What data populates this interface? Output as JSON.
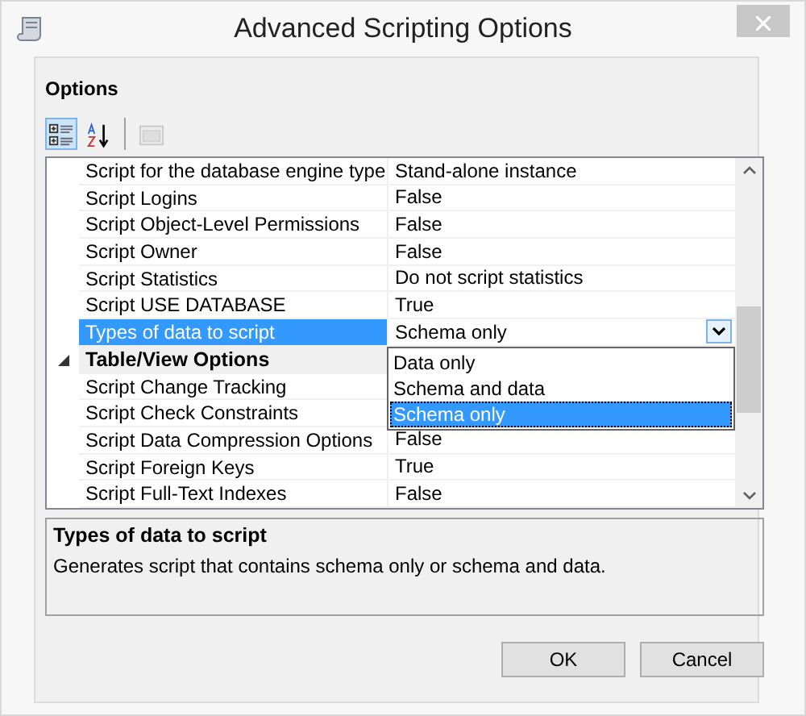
{
  "window": {
    "title": "Advanced Scripting Options"
  },
  "options_label": "Options",
  "toolbar": [
    {
      "kind": "categorized",
      "selected": true,
      "disabled": false
    },
    {
      "kind": "alphabetical",
      "selected": false,
      "disabled": false
    },
    {
      "kind": "property-pages",
      "selected": false,
      "disabled": true
    }
  ],
  "grid": {
    "rows": [
      {
        "kind": "property",
        "name": "Script for the database engine type",
        "value": "Stand-alone instance",
        "selected": false
      },
      {
        "kind": "property",
        "name": "Script Logins",
        "value": "False",
        "selected": false
      },
      {
        "kind": "property",
        "name": "Script Object-Level Permissions",
        "value": "False",
        "selected": false
      },
      {
        "kind": "property",
        "name": "Script Owner",
        "value": "False",
        "selected": false
      },
      {
        "kind": "property",
        "name": "Script Statistics",
        "value": "Do not script statistics",
        "selected": false
      },
      {
        "kind": "property",
        "name": "Script USE DATABASE",
        "value": "True",
        "selected": false
      },
      {
        "kind": "property",
        "name": "Types of data to script",
        "value": "Schema only",
        "selected": true
      },
      {
        "kind": "category",
        "name": "Table/View Options",
        "expanded": true
      },
      {
        "kind": "property",
        "name": "Script Change Tracking",
        "selected": false
      },
      {
        "kind": "property",
        "name": "Script Check Constraints",
        "selected": false
      },
      {
        "kind": "property",
        "name": "Script Data Compression Options",
        "value": "False",
        "selected": false
      },
      {
        "kind": "property",
        "name": "Script Foreign Keys",
        "value": "True",
        "selected": false
      },
      {
        "kind": "property",
        "name": "Script Full-Text Indexes",
        "value": "False",
        "selected": false
      }
    ]
  },
  "dropdown": {
    "items": [
      {
        "label": "Data only",
        "selected": false
      },
      {
        "label": "Schema and data",
        "selected": false
      },
      {
        "label": "Schema only",
        "selected": true
      }
    ]
  },
  "description": {
    "title": "Types of data to script",
    "text": "Generates script that contains schema only or schema and data."
  },
  "buttons": [
    "OK",
    "Cancel"
  ]
}
